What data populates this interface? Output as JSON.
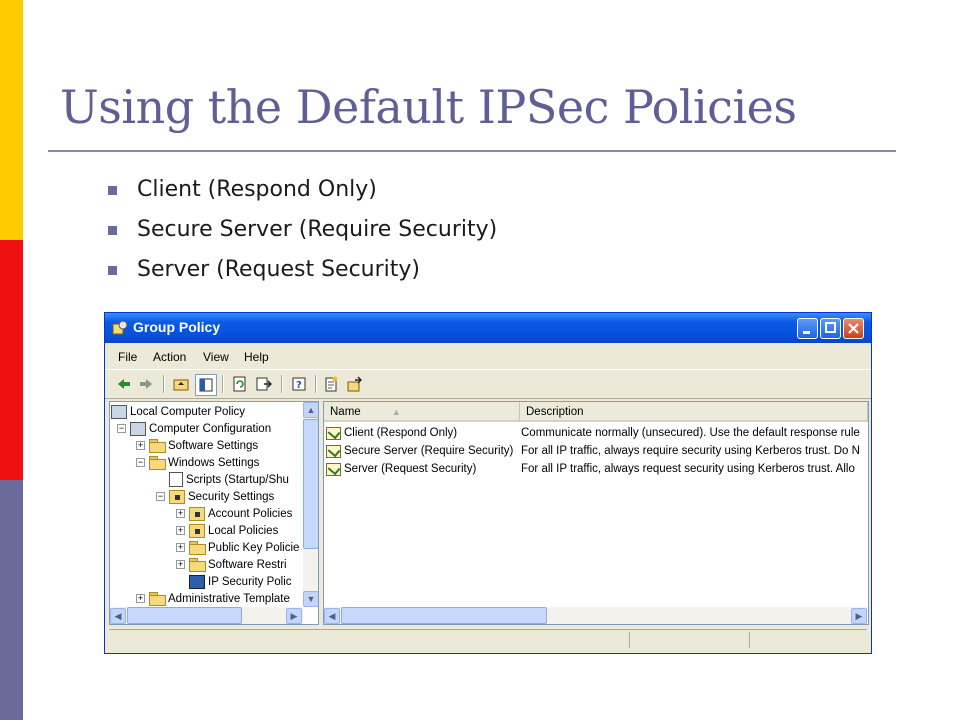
{
  "slide": {
    "title": "Using the Default IPSec Policies",
    "bullets": [
      "Client (Respond Only)",
      "Secure Server (Require Security)",
      "Server (Request Security)"
    ],
    "colors": {
      "title": "#5f5f95",
      "bar_yellow": "#ffcc00",
      "bar_red": "#ee1111",
      "bar_purple": "#6a6a9c"
    }
  },
  "window": {
    "title": "Group Policy",
    "menu": [
      "File",
      "Action",
      "View",
      "Help"
    ],
    "toolbar_icons": [
      "back-arrow-icon",
      "forward-arrow-icon",
      "up-folder-icon",
      "show-hide-tree-icon",
      "refresh-icon",
      "export-list-icon",
      "help-icon",
      "new-policy-icon",
      "manage-filters-icon"
    ],
    "tree": [
      {
        "label": "Local Computer Policy",
        "icon": "computer-policy-icon"
      },
      {
        "label": "Computer Configuration",
        "icon": "computer-icon"
      },
      {
        "label": "Software Settings",
        "icon": "folder-icon"
      },
      {
        "label": "Windows Settings",
        "icon": "folder-icon"
      },
      {
        "label": "Scripts (Startup/Shu",
        "icon": "script-icon"
      },
      {
        "label": "Security Settings",
        "icon": "security-icon"
      },
      {
        "label": "Account Policies",
        "icon": "folder-icon"
      },
      {
        "label": "Local Policies",
        "icon": "folder-icon"
      },
      {
        "label": "Public Key Policie",
        "icon": "folder-icon"
      },
      {
        "label": "Software Restri",
        "icon": "folder-icon"
      },
      {
        "label": "IP Security Polic",
        "icon": "ip-security-icon"
      },
      {
        "label": "Administrative Template",
        "icon": "folder-icon"
      }
    ],
    "columns": {
      "name": "Name",
      "description": "Description"
    },
    "rows": [
      {
        "name": "Client (Respond Only)",
        "description": "Communicate normally (unsecured). Use the default response rule"
      },
      {
        "name": "Secure Server (Require Security)",
        "description": "For all IP traffic, always require security using Kerberos trust. Do N"
      },
      {
        "name": "Server (Request Security)",
        "description": "For all IP traffic, always request security using Kerberos trust. Allo"
      }
    ]
  }
}
